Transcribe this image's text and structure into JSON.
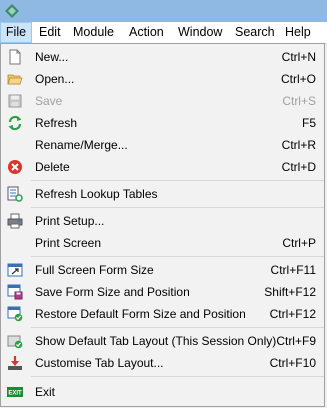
{
  "menubar": {
    "file": "File",
    "edit": "Edit",
    "module": "Module",
    "action": "Action",
    "window": "Window",
    "search": "Search",
    "help": "Help"
  },
  "menu": {
    "new": {
      "label": "New...",
      "shortcut": "Ctrl+N"
    },
    "open": {
      "label": "Open...",
      "shortcut": "Ctrl+O"
    },
    "save": {
      "label": "Save",
      "shortcut": "Ctrl+S",
      "enabled": false
    },
    "refresh": {
      "label": "Refresh",
      "shortcut": "F5"
    },
    "rename": {
      "label": "Rename/Merge...",
      "shortcut": "Ctrl+R"
    },
    "delete": {
      "label": "Delete",
      "shortcut": "Ctrl+D"
    },
    "refresh_lookup": {
      "label": "Refresh Lookup Tables"
    },
    "print_setup": {
      "label": "Print Setup..."
    },
    "print_screen": {
      "label": "Print Screen",
      "shortcut": "Ctrl+P"
    },
    "full_screen": {
      "label": "Full Screen Form Size",
      "shortcut": "Ctrl+F11"
    },
    "save_form": {
      "label": "Save Form Size and Position",
      "shortcut": "Shift+F12"
    },
    "restore_form": {
      "label": "Restore Default Form Size and Position",
      "shortcut": "Ctrl+F12"
    },
    "show_tab": {
      "label": "Show Default Tab Layout (This Session Only)",
      "shortcut": "Ctrl+F9"
    },
    "customise_tab": {
      "label": "Customise Tab Layout...",
      "shortcut": "Ctrl+F10"
    },
    "exit": {
      "label": "Exit",
      "icon_text": "EXIT"
    }
  },
  "icons": {
    "app": "app-diamond-icon",
    "new": "new-document-icon",
    "open": "open-folder-icon",
    "save": "save-disk-icon",
    "refresh": "refresh-arrows-icon",
    "delete": "delete-x-icon",
    "refresh_lookup": "lookup-table-icon",
    "print_setup": "printer-settings-icon",
    "full_screen": "fullscreen-icon",
    "save_form": "save-form-icon",
    "restore_form": "restore-form-icon",
    "show_tab": "tab-layout-check-icon",
    "customise_tab": "customise-tab-icon",
    "exit": "exit-sign-icon"
  },
  "colors": {
    "title_bar": "#8fb8e2",
    "menu_highlight": "#cce4f7",
    "delete_red": "#d9362b",
    "refresh_green": "#2f9e44",
    "exit_green": "#1e8c2e",
    "disabled_text": "#a0a0a0"
  }
}
